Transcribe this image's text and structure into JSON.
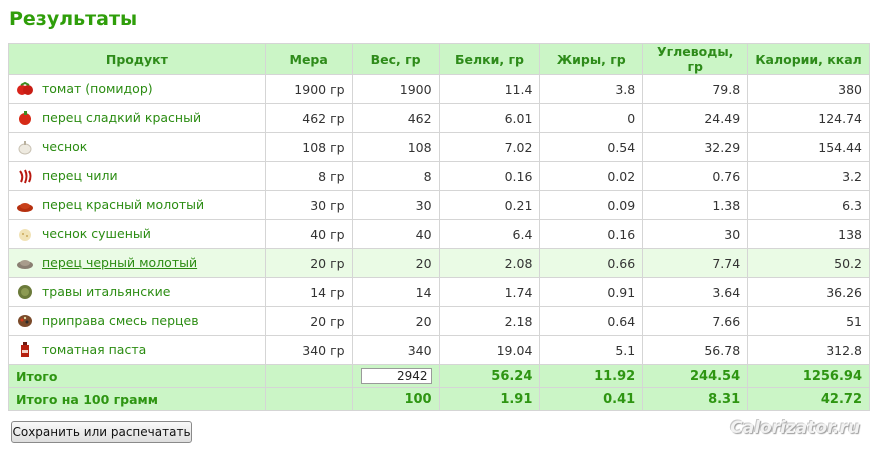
{
  "page": {
    "title": "Результаты"
  },
  "table": {
    "headers": [
      "Продукт",
      "Мера",
      "Вес, гр",
      "Белки, гр",
      "Жиры, гр",
      "Углеводы, гр",
      "Калории, ккал"
    ],
    "rows": [
      {
        "product": "томат (помидор)",
        "icon": "tomato-icon",
        "measure": "1900 гр",
        "weight": "1900",
        "protein": "11.4",
        "fat": "3.8",
        "carbs": "79.8",
        "kcal": "380"
      },
      {
        "product": "перец сладкий красный",
        "icon": "red-pepper-icon",
        "measure": "462 гр",
        "weight": "462",
        "protein": "6.01",
        "fat": "0",
        "carbs": "24.49",
        "kcal": "124.74"
      },
      {
        "product": "чеснок",
        "icon": "garlic-icon",
        "measure": "108 гр",
        "weight": "108",
        "protein": "7.02",
        "fat": "0.54",
        "carbs": "32.29",
        "kcal": "154.44"
      },
      {
        "product": "перец чили",
        "icon": "chili-pepper-icon",
        "measure": "8 гр",
        "weight": "8",
        "protein": "0.16",
        "fat": "0.02",
        "carbs": "0.76",
        "kcal": "3.2"
      },
      {
        "product": "перец красный молотый",
        "icon": "ground-red-pepper-icon",
        "measure": "30 гр",
        "weight": "30",
        "protein": "0.21",
        "fat": "0.09",
        "carbs": "1.38",
        "kcal": "6.3"
      },
      {
        "product": "чеснок сушеный",
        "icon": "dried-garlic-icon",
        "measure": "40 гр",
        "weight": "40",
        "protein": "6.4",
        "fat": "0.16",
        "carbs": "30",
        "kcal": "138"
      },
      {
        "product": "перец черный молотый",
        "icon": "ground-black-pepper-icon",
        "measure": "20 гр",
        "weight": "20",
        "protein": "2.08",
        "fat": "0.66",
        "carbs": "7.74",
        "kcal": "50.2"
      },
      {
        "product": "травы итальянские",
        "icon": "italian-herbs-icon",
        "measure": "14 гр",
        "weight": "14",
        "protein": "1.74",
        "fat": "0.91",
        "carbs": "3.64",
        "kcal": "36.26"
      },
      {
        "product": "приправа смесь перцев",
        "icon": "pepper-mix-icon",
        "measure": "20 гр",
        "weight": "20",
        "protein": "2.18",
        "fat": "0.64",
        "carbs": "7.66",
        "kcal": "51"
      },
      {
        "product": "томатная паста",
        "icon": "tomato-paste-icon",
        "measure": "340 гр",
        "weight": "340",
        "protein": "19.04",
        "fat": "5.1",
        "carbs": "56.78",
        "kcal": "312.8"
      }
    ],
    "highlighted_row": 6,
    "total": {
      "label": "Итого",
      "weight": "2942",
      "protein": "56.24",
      "fat": "11.92",
      "carbs": "244.54",
      "kcal": "1256.94"
    },
    "per100": {
      "label": "Итого на 100 грамм",
      "weight": "100",
      "protein": "1.91",
      "fat": "0.41",
      "carbs": "8.31",
      "kcal": "42.72"
    }
  },
  "actions": {
    "save_print_label": "Сохранить или распечатать"
  },
  "watermark": {
    "text": "Calorizator.ru"
  },
  "colors": {
    "accent": "#2f9e0a",
    "header_bg": "#cbf5c6",
    "highlight_bg": "#eafbe5"
  }
}
